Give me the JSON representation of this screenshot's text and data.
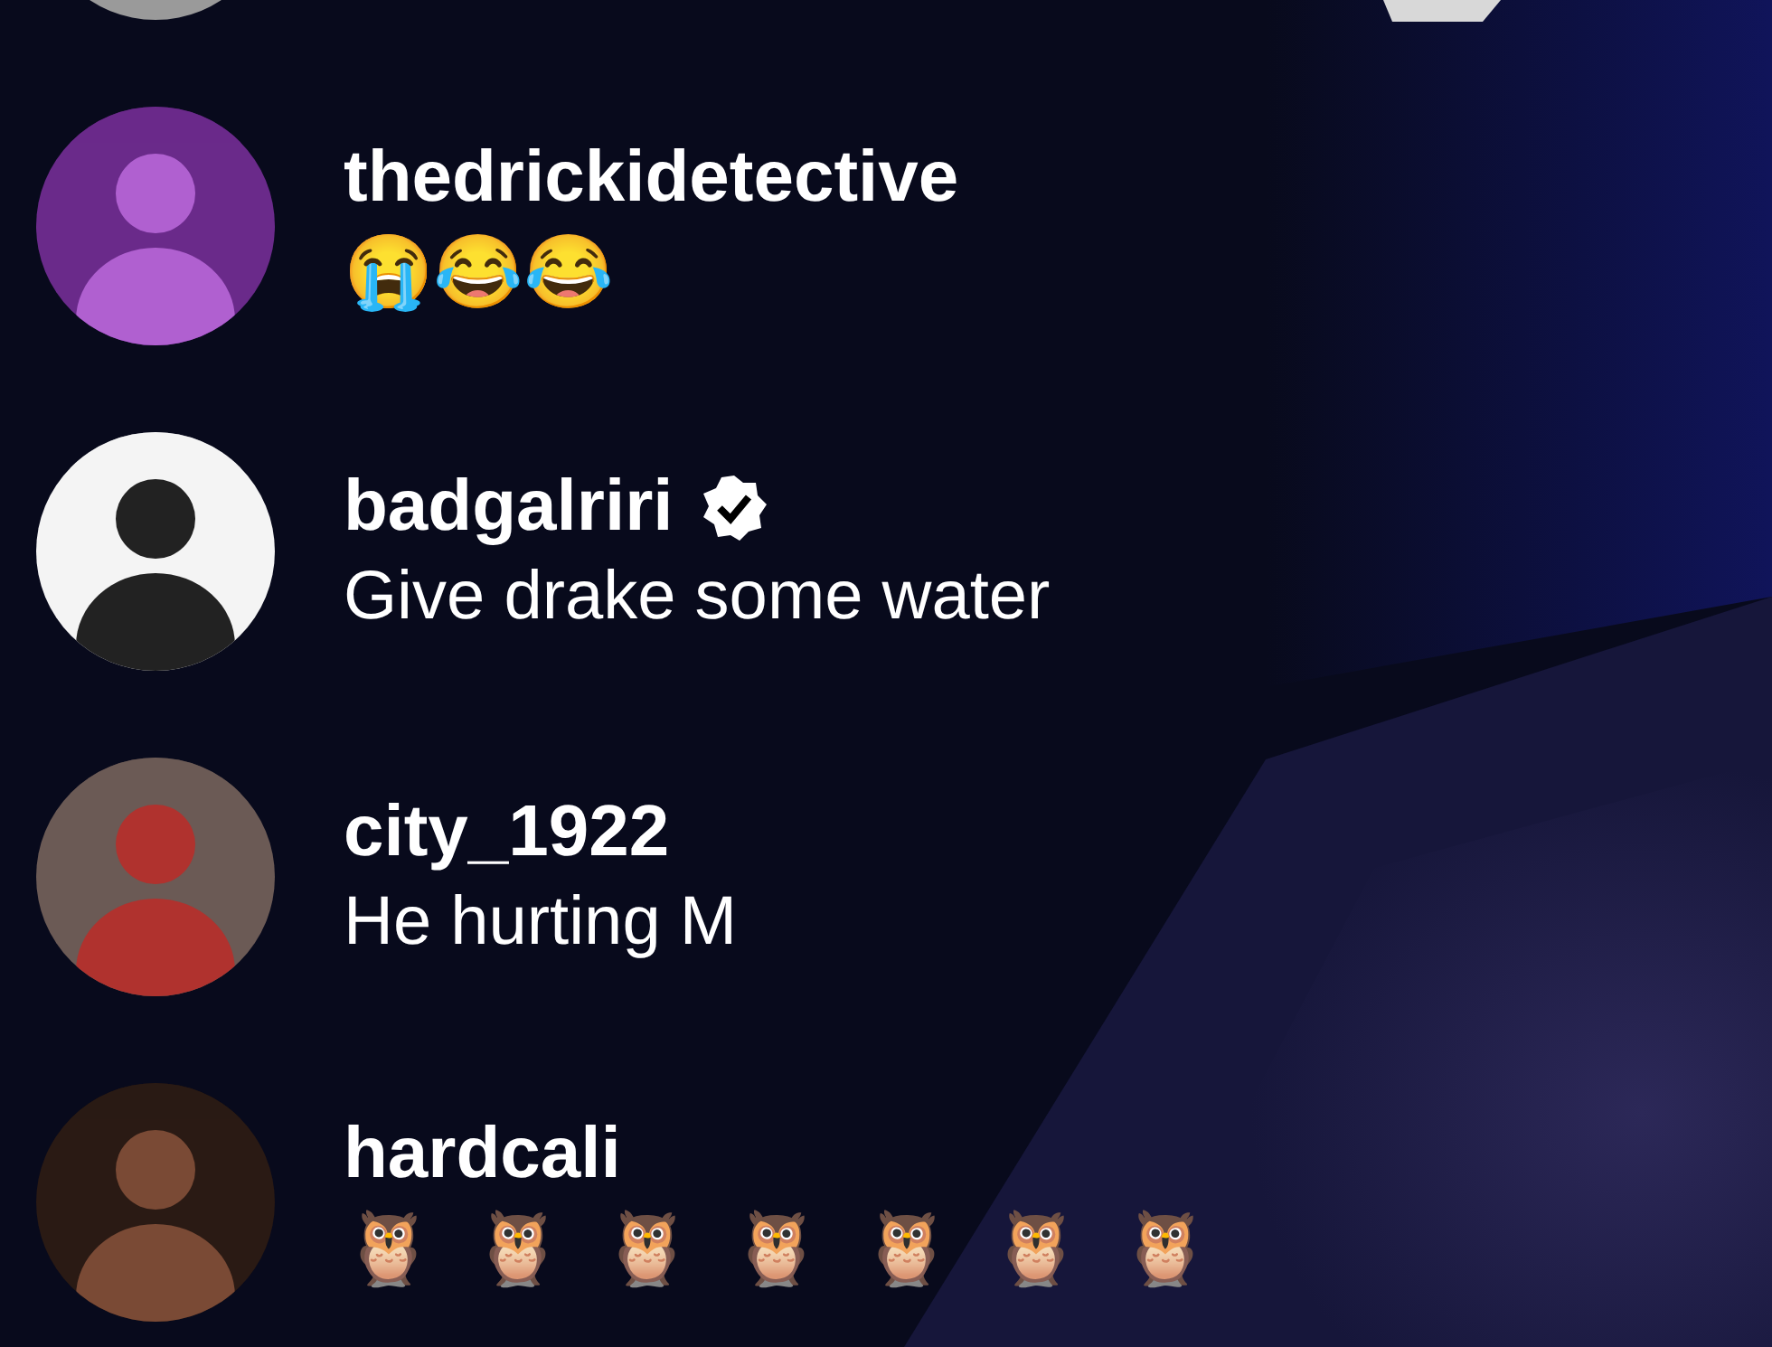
{
  "comments": [
    {
      "username": "thedrickidetective",
      "verified": false,
      "emojis": "😭😂😂"
    },
    {
      "username": "badgalriri",
      "verified": true,
      "message": "Give drake some water"
    },
    {
      "username": "city_1922",
      "verified": false,
      "message": "He hurting M"
    },
    {
      "username": "hardcali",
      "verified": false,
      "emojis": "🦉 🦉 🦉 🦉 🦉 🦉 🦉"
    }
  ]
}
